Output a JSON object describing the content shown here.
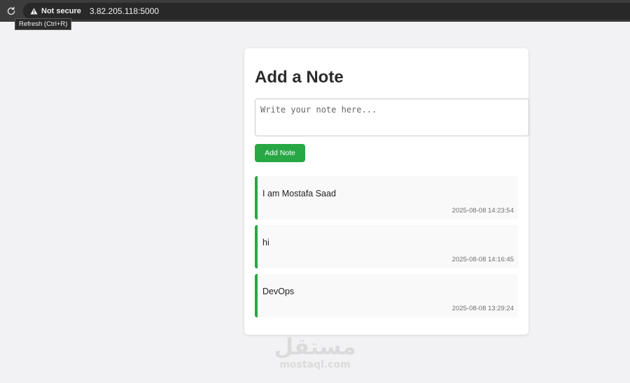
{
  "browser": {
    "security_label": "Not secure",
    "url": "3.82.205.118:5000",
    "reload_tooltip": "Refresh (Ctrl+R)",
    "icons": {
      "reload": "reload-icon",
      "warning": "warning-icon"
    }
  },
  "page": {
    "title": "Add a Note",
    "input_placeholder": "Write your note here...",
    "input_value": "",
    "add_button_label": "Add Note",
    "accent_color": "#28a745"
  },
  "notes": [
    {
      "text": "I am Mostafa Saad",
      "timestamp": "2025-08-08 14:23:54"
    },
    {
      "text": "hi",
      "timestamp": "2025-08-08 14:16:45"
    },
    {
      "text": "DevOps",
      "timestamp": "2025-08-08 13:29:24"
    }
  ],
  "watermark": {
    "main": "مستقل",
    "sub": "mostaql.com"
  }
}
